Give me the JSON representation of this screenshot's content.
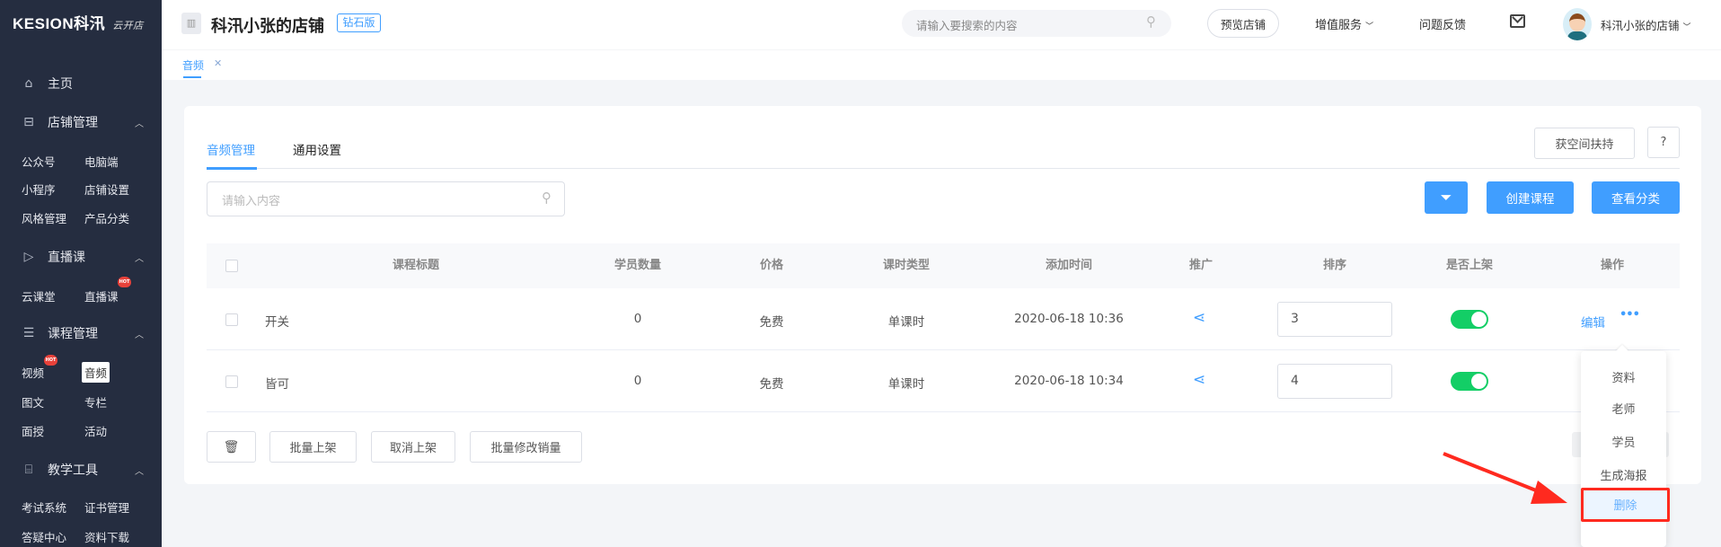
{
  "sidebar": {
    "logo": "KESION科汛",
    "logo_script": "云开店",
    "groups": [
      {
        "label": "主页",
        "icon": "home-icon"
      },
      {
        "label": "店铺管理",
        "icon": "store-icon",
        "items": [
          "公众号",
          "电脑端",
          "小程序",
          "店铺设置",
          "风格管理",
          "产品分类"
        ]
      },
      {
        "label": "直播课",
        "icon": "live-icon",
        "items": [
          "云课堂",
          "直播课"
        ]
      },
      {
        "label": "课程管理",
        "icon": "course-icon",
        "items": [
          "视频",
          "音频",
          "图文",
          "专栏",
          "面授",
          "活动"
        ]
      },
      {
        "label": "教学工具",
        "icon": "tools-icon",
        "items": [
          "考试系统",
          "证书管理",
          "答疑中心",
          "资料下载"
        ]
      }
    ],
    "hot_badge": "HOT",
    "active_item": "音频"
  },
  "header": {
    "store_name": "科汛小张的店铺",
    "edition_badge": "钻石版",
    "search_placeholder": "请输入要搜索的内容",
    "preview_button": "预览店铺",
    "value_services": "增值服务",
    "feedback": "问题反馈",
    "user_name": "科汛小张的店铺"
  },
  "open_tabs": [
    {
      "label": "音频"
    }
  ],
  "main": {
    "tabs": [
      "音频管理",
      "通用设置"
    ],
    "active_tab": "音频管理",
    "space_button": "获空间扶持",
    "help_button": "?",
    "search_placeholder": "请输入内容",
    "create_button": "创建课程",
    "category_button": "查看分类",
    "table": {
      "columns": [
        "课程标题",
        "学员数量",
        "价格",
        "课时类型",
        "添加时间",
        "推广",
        "排序",
        "是否上架",
        "操作"
      ],
      "rows": [
        {
          "title": "开关",
          "students": "0",
          "price": "免费",
          "type": "单课时",
          "added": "2020-06-18 10:36",
          "sort": "3",
          "listed": true,
          "edit": "编辑"
        },
        {
          "title": "皆可",
          "students": "0",
          "price": "免费",
          "type": "单课时",
          "added": "2020-06-18 10:34",
          "sort": "4",
          "listed": true
        }
      ]
    },
    "bulk_buttons": [
      "批量上架",
      "取消上架",
      "批量修改销量"
    ],
    "more_menu": [
      "资料",
      "老师",
      "学员",
      "生成海报",
      "删除"
    ],
    "highlighted_menu_item": "删除"
  },
  "colors": {
    "primary": "#409eff",
    "sidebar": "#252d40",
    "toggle_on": "#13ce66",
    "annotation": "#ff2a1f"
  }
}
